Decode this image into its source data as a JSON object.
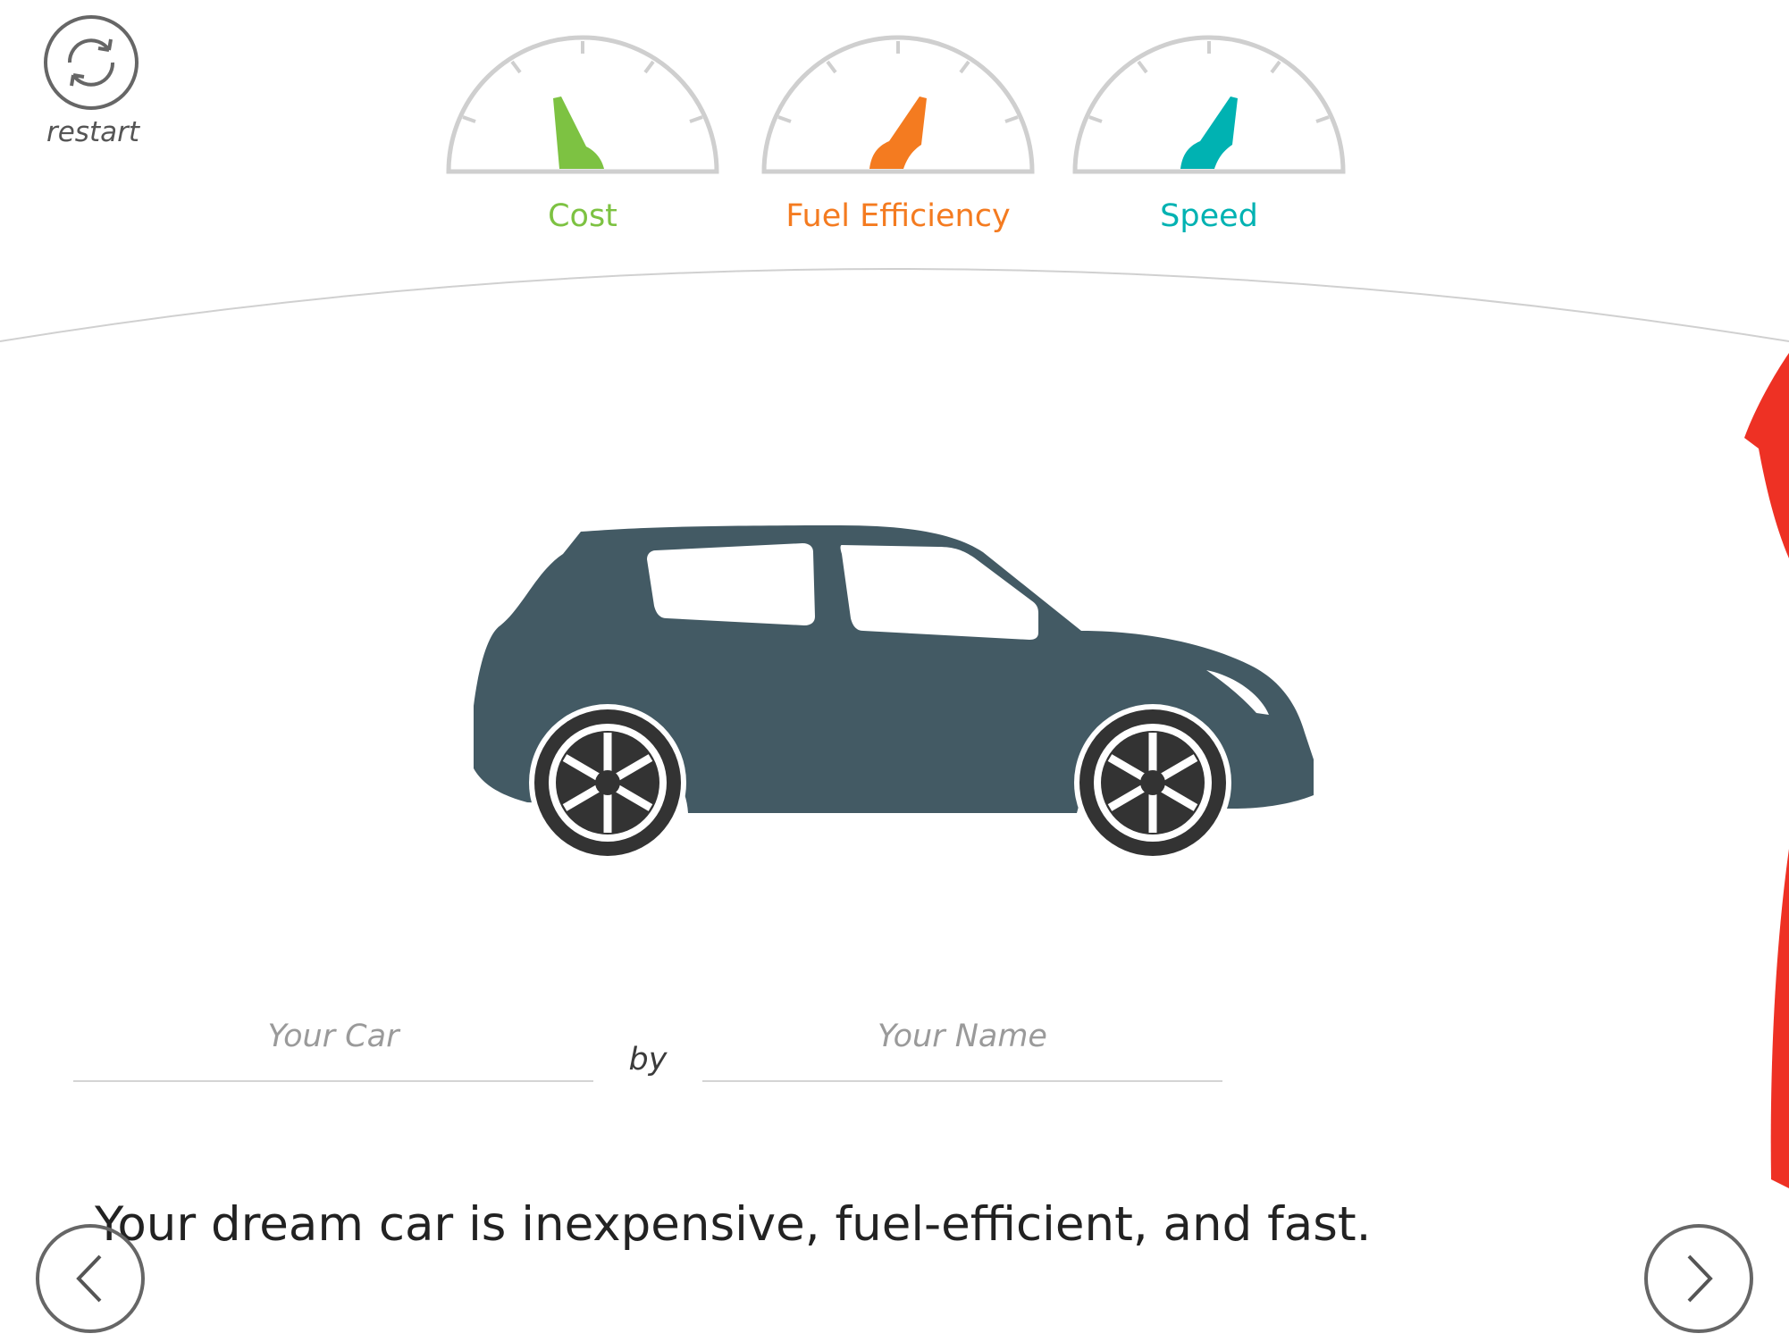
{
  "app": {
    "restart_label": "restart"
  },
  "gauges": [
    {
      "label": "Cost",
      "color": "#7dc242"
    },
    {
      "label": "Fuel Efficiency",
      "color": "#f47b20"
    },
    {
      "label": "Speed",
      "color": "#00b2b2"
    }
  ],
  "card": {
    "car_name_placeholder": "Your Car",
    "by_label": "by",
    "author_placeholder": "Your Name",
    "car_color": "#435a64"
  },
  "summary": "Your dream car is inexpensive, fuel-efficient, and fast.",
  "nav": {
    "prev_icon": "chevron-left-icon",
    "next_icon": "chevron-right-icon"
  },
  "colors": {
    "accent_red": "#ee3124",
    "gauge_frame": "#cfcfcf",
    "divider": "#d0d0d0"
  }
}
